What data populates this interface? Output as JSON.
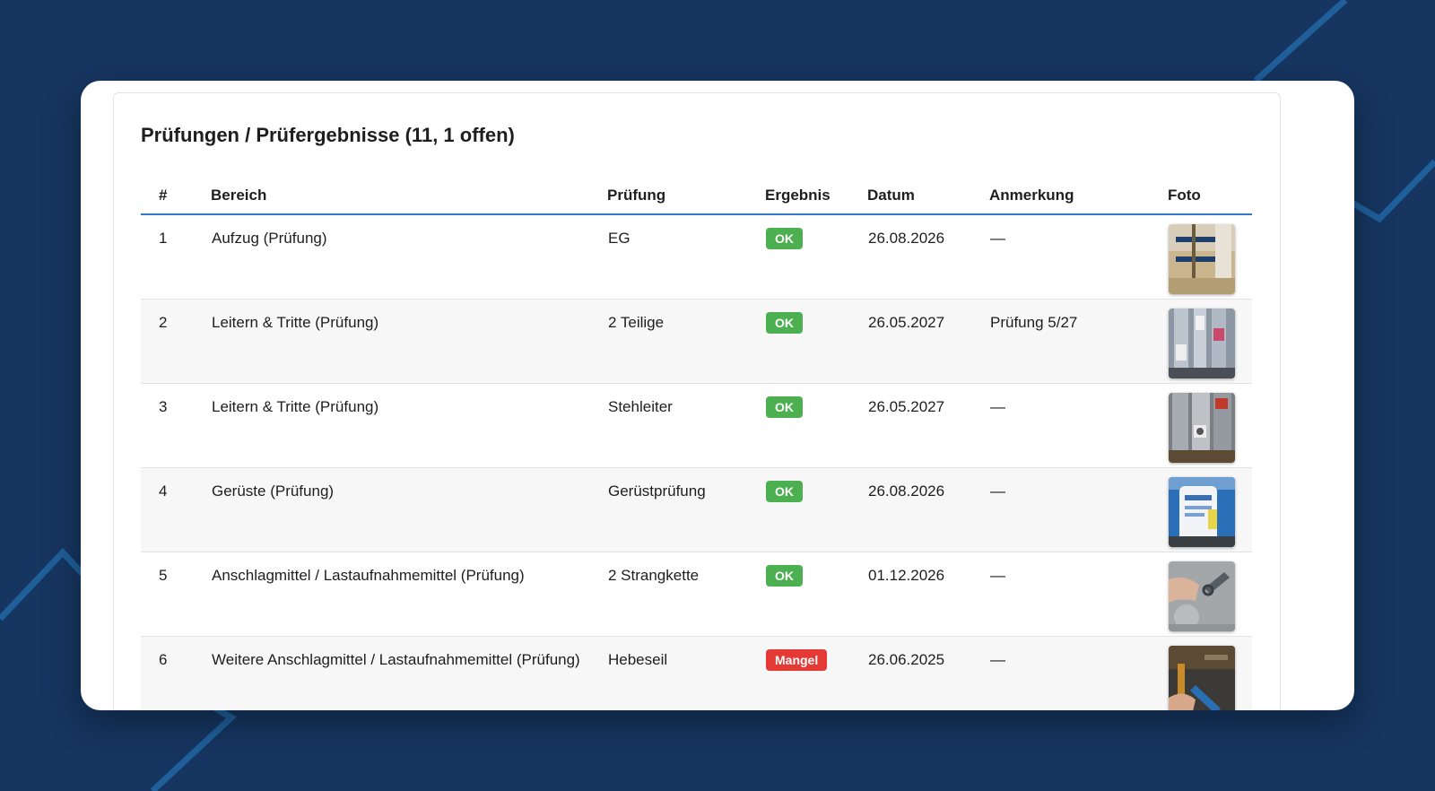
{
  "section": {
    "title": "Prüfungen / Prüfergebnisse (11, 1 offen)"
  },
  "table": {
    "headers": {
      "num": "#",
      "bereich": "Bereich",
      "pruefung": "Prüfung",
      "ergebnis": "Ergebnis",
      "datum": "Datum",
      "anmerkung": "Anmerkung",
      "foto": "Foto"
    },
    "rows": [
      {
        "num": "1",
        "bereich": "Aufzug (Prüfung)",
        "pruefung": "EG",
        "ergebnis": "OK",
        "status": "ok",
        "datum": "26.08.2026",
        "anmerkung": "—",
        "foto_icon": "elevator-photo-thumbnail"
      },
      {
        "num": "2",
        "bereich": "Leitern & Tritte (Prüfung)",
        "pruefung": "2 Teilige",
        "ergebnis": "OK",
        "status": "ok",
        "datum": "26.05.2027",
        "anmerkung": "Prüfung 5/27",
        "foto_icon": "ladder-label-photo-thumbnail"
      },
      {
        "num": "3",
        "bereich": "Leitern & Tritte (Prüfung)",
        "pruefung": "Stehleiter",
        "ergebnis": "OK",
        "status": "ok",
        "datum": "26.05.2027",
        "anmerkung": "—",
        "foto_icon": "stepladder-photo-thumbnail"
      },
      {
        "num": "4",
        "bereich": "Gerüste (Prüfung)",
        "pruefung": "Gerüstprüfung",
        "ergebnis": "OK",
        "status": "ok",
        "datum": "26.08.2026",
        "anmerkung": "—",
        "foto_icon": "scaffold-tag-photo-thumbnail"
      },
      {
        "num": "5",
        "bereich": "Anschlagmittel / Lastaufnahmemittel (Prüfung)",
        "pruefung": "2 Strangkette",
        "ergebnis": "OK",
        "status": "ok",
        "datum": "01.12.2026",
        "anmerkung": "—",
        "foto_icon": "chain-photo-thumbnail"
      },
      {
        "num": "6",
        "bereich": "Weitere Anschlagmittel / Lastaufnahmemittel (Prüfung)",
        "pruefung": "Hebeseil",
        "ergebnis": "Mangel",
        "status": "mangel",
        "datum": "26.06.2025",
        "anmerkung": "—",
        "foto_icon": "rope-photo-thumbnail"
      }
    ]
  },
  "colors": {
    "background": "#163560",
    "accent_line": "#2f78c4",
    "ok": "#4caf50",
    "mangel": "#e53935"
  }
}
